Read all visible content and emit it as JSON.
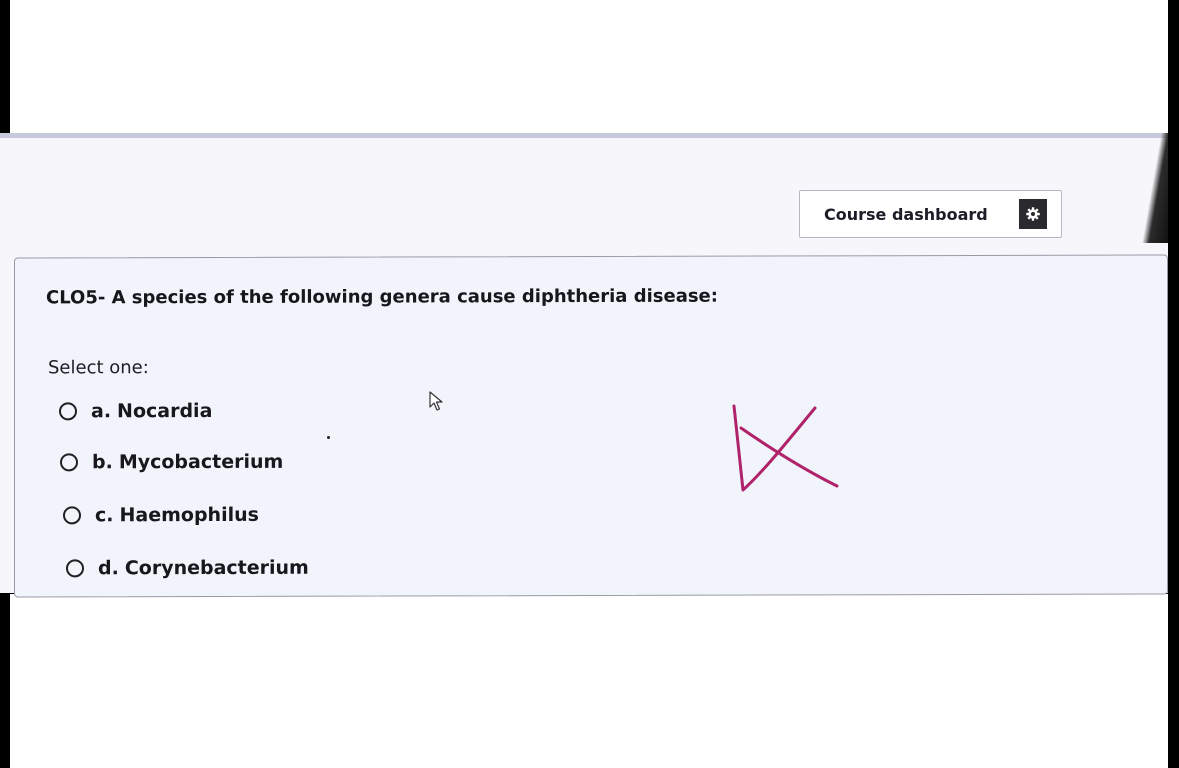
{
  "dashboard": {
    "label": "Course dashboard",
    "icon": "gear-icon"
  },
  "question": {
    "text": "CLO5- A species of the following genera cause diphtheria disease:",
    "prompt": "Select one:",
    "options": [
      {
        "letter": "a.",
        "label": "Nocardia"
      },
      {
        "letter": "b.",
        "label": "Mycobacterium"
      },
      {
        "letter": "c.",
        "label": "Haemophilus"
      },
      {
        "letter": "d.",
        "label": "Corynebacterium"
      }
    ]
  },
  "annotation": {
    "mark": "X",
    "color": "#b0226a"
  }
}
